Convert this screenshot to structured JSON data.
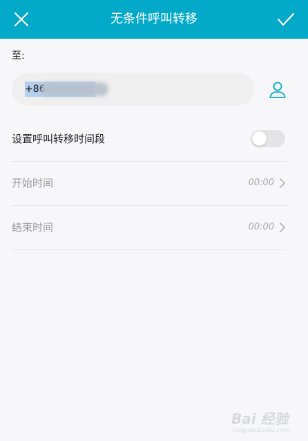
{
  "header": {
    "title": "无条件呼叫转移",
    "accent_color": "#03a9c9"
  },
  "form": {
    "to_label": "至:",
    "phone_prefix": "+86",
    "contact_icon": "contact-person-icon"
  },
  "settings": {
    "period_label": "设置呼叫转移时间段",
    "period_enabled": false,
    "start_label": "开始时间",
    "start_value": "00:00",
    "end_label": "结束时间",
    "end_value": "00:00"
  },
  "watermark": {
    "brand": "Bai 经验",
    "url": "jingyan.baidu.com"
  }
}
